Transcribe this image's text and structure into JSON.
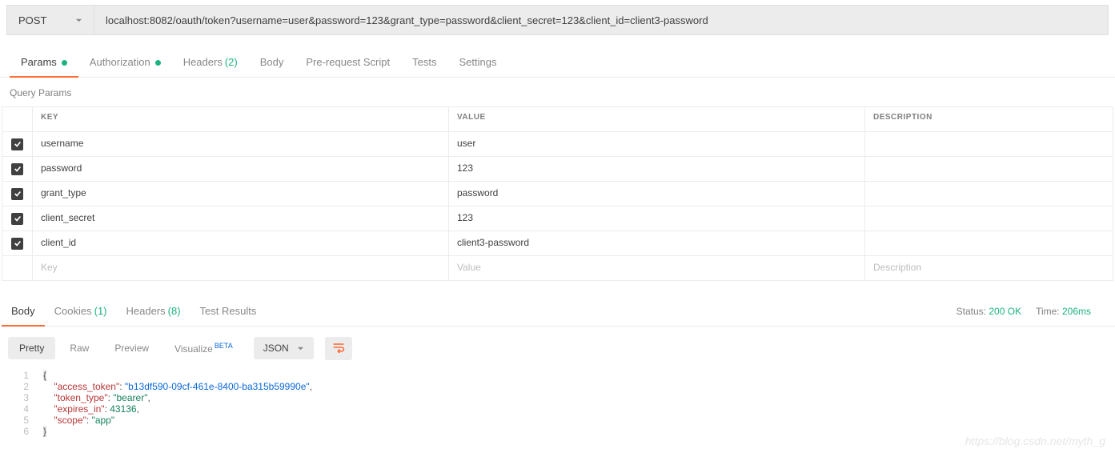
{
  "request": {
    "method": "POST",
    "url": "localhost:8082/oauth/token?username=user&password=123&grant_type=password&client_secret=123&client_id=client3-password"
  },
  "req_tabs": {
    "params": "Params",
    "auth": "Authorization",
    "headers": "Headers",
    "headers_count": "(2)",
    "body": "Body",
    "prereq": "Pre-request Script",
    "tests": "Tests",
    "settings": "Settings"
  },
  "section_title": "Query Params",
  "table": {
    "head_key": "KEY",
    "head_val": "VALUE",
    "head_desc": "DESCRIPTION",
    "rows": [
      {
        "key": "username",
        "value": "user"
      },
      {
        "key": "password",
        "value": "123"
      },
      {
        "key": "grant_type",
        "value": "password"
      },
      {
        "key": "client_secret",
        "value": "123"
      },
      {
        "key": "client_id",
        "value": "client3-password"
      }
    ],
    "ph_key": "Key",
    "ph_val": "Value",
    "ph_desc": "Description"
  },
  "resp_tabs": {
    "body": "Body",
    "cookies": "Cookies",
    "cookies_count": "(1)",
    "headers": "Headers",
    "headers_count": "(8)",
    "tests": "Test Results"
  },
  "status": {
    "status_lbl": "Status:",
    "status_val": "200 OK",
    "time_lbl": "Time:",
    "time_val": "206ms"
  },
  "body_toolbar": {
    "pretty": "Pretty",
    "raw": "Raw",
    "preview": "Preview",
    "visualize": "Visualize",
    "beta": "BETA",
    "format": "JSON"
  },
  "json_body": [
    "{",
    "    \"access_token\": \"b13df590-09cf-461e-8400-ba315b59990e\",",
    "    \"token_type\": \"bearer\",",
    "    \"expires_in\": 43136,",
    "    \"scope\": \"app\"",
    "}"
  ],
  "watermark": "https://blog.csdn.net/myth_g"
}
